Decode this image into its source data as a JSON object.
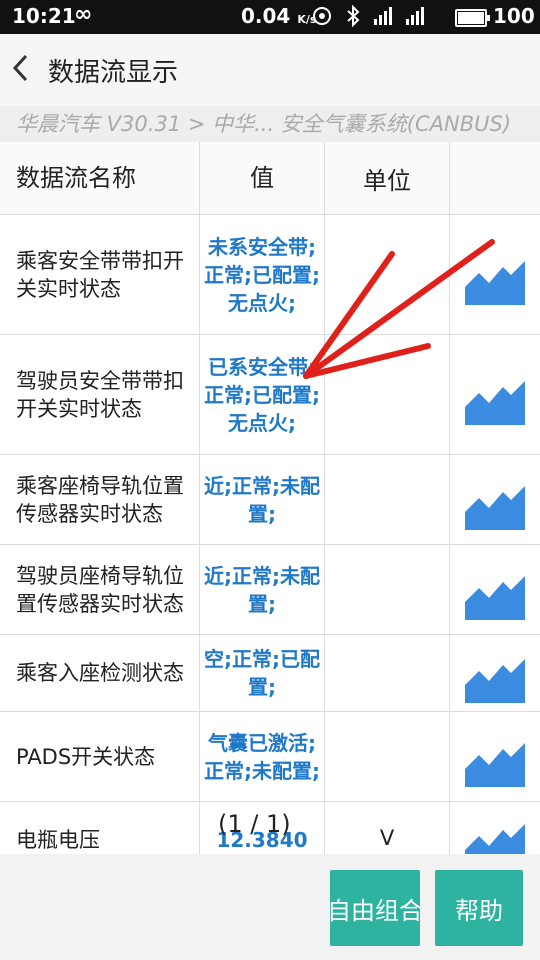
{
  "status_bar": {
    "time": "10:21",
    "infinity": "∞",
    "speed": "0.04",
    "speed_unit": "K/s",
    "battery_level": "100",
    "battery_fraction": 1.0
  },
  "header": {
    "title": "数据流显示"
  },
  "breadcrumb": "华晨汽车 V30.31 > 中华... 安全气囊系统(CANBUS)",
  "table": {
    "columns": [
      "数据流名称",
      "值",
      "单位",
      ""
    ],
    "rows": [
      {
        "name": "乘客安全带带扣开关实时状态",
        "value": "未系安全带;正常;已配置;无点火;",
        "unit": ""
      },
      {
        "name": "驾驶员安全带带扣开关实时状态",
        "value": "已系安全带;正常;已配置;无点火;",
        "unit": ""
      },
      {
        "name": "乘客座椅导轨位置传感器实时状态",
        "value": "近;正常;未配置;",
        "unit": ""
      },
      {
        "name": "驾驶员座椅导轨位置传感器实时状态",
        "value": "近;正常;未配置;",
        "unit": ""
      },
      {
        "name": "乘客入座检测状态",
        "value": "空;正常;已配置;",
        "unit": ""
      },
      {
        "name": "PADS开关状态",
        "value": "气囊已激活;正常;未配置;",
        "unit": ""
      },
      {
        "name": "电瓶电压",
        "value": "12.3840",
        "unit": "V"
      }
    ]
  },
  "page_indicator": "(1 / 1)",
  "buttons": {
    "free_combine": "自由组合",
    "help": "帮助"
  },
  "colors": {
    "accent_button": "#2db3a0",
    "value_text": "#1f78c8",
    "annotation_arrow": "#e0201a"
  }
}
